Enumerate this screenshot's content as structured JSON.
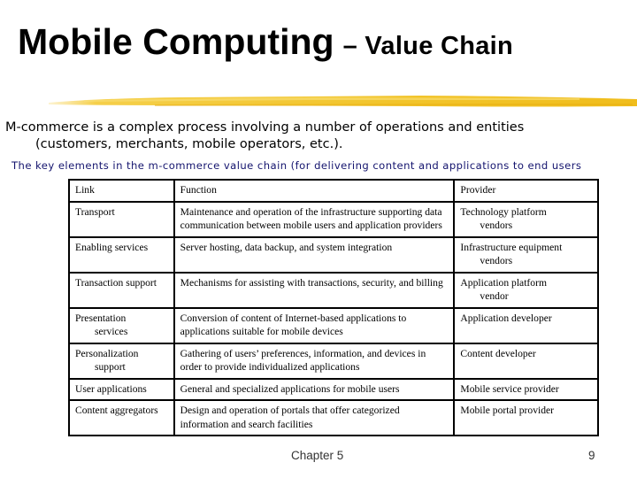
{
  "slide": {
    "title_main": "Mobile Computing",
    "title_sub": "– Value Chain",
    "accent_color": "#f2c21e",
    "intro_line1": "M-commerce is a complex process involving a number of operations and entities",
    "intro_line2": "(customers, merchants, mobile operators, etc.).",
    "key_elements_caption": "The key elements in the m-commerce value chain (for delivering content and applications to end users",
    "caption_color": "#14146e"
  },
  "table": {
    "headers": [
      "Link",
      "Function",
      "Provider"
    ],
    "rows": [
      {
        "link": [
          "Transport"
        ],
        "function": "Maintenance and operation of the infrastructure supporting data communication between mobile users and application providers",
        "provider": [
          "Technology platform",
          "vendors"
        ]
      },
      {
        "link": [
          "Enabling services"
        ],
        "function": "Server hosting, data backup, and system integration",
        "provider": [
          "Infrastructure equipment",
          "vendors"
        ]
      },
      {
        "link": [
          "Transaction support"
        ],
        "function": "Mechanisms for assisting with transactions, security, and billing",
        "provider": [
          "Application platform",
          "vendor"
        ]
      },
      {
        "link": [
          "Presentation",
          "services"
        ],
        "function": "Conversion of content of Internet-based applications to applications suitable for mobile devices",
        "provider": [
          "Application developer"
        ]
      },
      {
        "link": [
          "Personalization",
          "support"
        ],
        "function": "Gathering of users’ preferences, information, and devices in order to provide individualized applications",
        "provider": [
          "Content developer"
        ]
      },
      {
        "link": [
          "User applications"
        ],
        "function": "General and specialized applications for mobile users",
        "provider": [
          "Mobile service provider"
        ]
      },
      {
        "link": [
          "Content aggregators"
        ],
        "function": "Design and operation of portals that offer categorized information and search facilities",
        "provider": [
          "Mobile portal provider"
        ]
      }
    ]
  },
  "footer": {
    "chapter": "Chapter 5",
    "page_number": "9"
  }
}
